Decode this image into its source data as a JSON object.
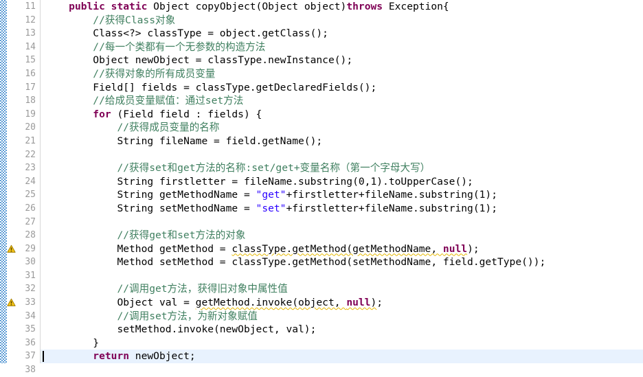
{
  "editor": {
    "app": "eclipse-java-editor",
    "language": "Java",
    "colors": {
      "keyword": "#7F0055",
      "string": "#2A00FF",
      "comment": "#3F7F5F",
      "plain": "#000000",
      "line_number": "#9A9A9A",
      "current_line_highlight": "#E8F2FE",
      "warning_underline": "#E6B800",
      "annotation_strip": "#5B9BD5"
    },
    "first_line_number": 11,
    "last_line_number": 38,
    "current_line": 37,
    "fold_marker_line": 11,
    "fold_marker_glyph": "⊖",
    "warning_lines": [
      29,
      33
    ]
  },
  "lines": [
    {
      "num": "11",
      "marker": "fold",
      "indent": 4,
      "tokens": [
        {
          "t": "kw",
          "v": "public"
        },
        {
          "t": "plain",
          "v": " "
        },
        {
          "t": "kw",
          "v": "static"
        },
        {
          "t": "plain",
          "v": " Object copyObject(Object object)"
        },
        {
          "t": "kw",
          "v": "throws"
        },
        {
          "t": "plain",
          "v": " Exception{"
        }
      ]
    },
    {
      "num": "12",
      "marker": "none",
      "indent": 8,
      "tokens": [
        {
          "t": "cmt",
          "v": "//获得Class对象"
        }
      ]
    },
    {
      "num": "13",
      "marker": "none",
      "indent": 8,
      "tokens": [
        {
          "t": "plain",
          "v": "Class<?> classType = object.getClass();"
        }
      ]
    },
    {
      "num": "14",
      "marker": "none",
      "indent": 8,
      "tokens": [
        {
          "t": "cmt",
          "v": "//每一个类都有一个无参数的构造方法"
        }
      ]
    },
    {
      "num": "15",
      "marker": "none",
      "indent": 8,
      "tokens": [
        {
          "t": "plain",
          "v": "Object newObject = classType.newInstance();"
        }
      ]
    },
    {
      "num": "16",
      "marker": "none",
      "indent": 8,
      "tokens": [
        {
          "t": "cmt",
          "v": "//获得对象的所有成员变量"
        }
      ]
    },
    {
      "num": "17",
      "marker": "none",
      "indent": 8,
      "tokens": [
        {
          "t": "plain",
          "v": "Field[] fields = classType.getDeclaredFields();"
        }
      ]
    },
    {
      "num": "18",
      "marker": "none",
      "indent": 8,
      "tokens": [
        {
          "t": "cmt",
          "v": "//给成员变量赋值：通过set方法"
        }
      ]
    },
    {
      "num": "19",
      "marker": "none",
      "indent": 8,
      "tokens": [
        {
          "t": "kw",
          "v": "for"
        },
        {
          "t": "plain",
          "v": " (Field field : fields) {"
        }
      ]
    },
    {
      "num": "20",
      "marker": "none",
      "indent": 12,
      "tokens": [
        {
          "t": "cmt",
          "v": "//获得成员变量的名称"
        }
      ]
    },
    {
      "num": "21",
      "marker": "none",
      "indent": 12,
      "tokens": [
        {
          "t": "plain",
          "v": "String fileName = field.getName();"
        }
      ]
    },
    {
      "num": "22",
      "marker": "none",
      "indent": 0,
      "tokens": []
    },
    {
      "num": "23",
      "marker": "none",
      "indent": 12,
      "tokens": [
        {
          "t": "cmt",
          "v": "//获得set和get方法的名称:set/get+变量名称（第一个字母大写）"
        }
      ]
    },
    {
      "num": "24",
      "marker": "none",
      "indent": 12,
      "tokens": [
        {
          "t": "plain",
          "v": "String firstletter = fileName.substring(0,1).toUpperCase();"
        }
      ]
    },
    {
      "num": "25",
      "marker": "none",
      "indent": 12,
      "tokens": [
        {
          "t": "plain",
          "v": "String getMethodName = "
        },
        {
          "t": "str",
          "v": "\"get\""
        },
        {
          "t": "plain",
          "v": "+firstletter+fileName.substring(1);"
        }
      ]
    },
    {
      "num": "26",
      "marker": "none",
      "indent": 12,
      "tokens": [
        {
          "t": "plain",
          "v": "String setMethodName = "
        },
        {
          "t": "str",
          "v": "\"set\""
        },
        {
          "t": "plain",
          "v": "+firstletter+fileName.substring(1);"
        }
      ]
    },
    {
      "num": "27",
      "marker": "none",
      "indent": 0,
      "tokens": []
    },
    {
      "num": "28",
      "marker": "none",
      "indent": 12,
      "tokens": [
        {
          "t": "cmt",
          "v": "//获得get和set方法的对象"
        }
      ]
    },
    {
      "num": "29",
      "marker": "warning",
      "indent": 12,
      "tokens": [
        {
          "t": "plain",
          "v": "Method getMethod = "
        },
        {
          "t": "plain-warn",
          "v": "classType.getMethod(getMethodName, "
        },
        {
          "t": "kw-warn",
          "v": "null"
        },
        {
          "t": "plain",
          "v": ");"
        }
      ]
    },
    {
      "num": "30",
      "marker": "none",
      "indent": 12,
      "tokens": [
        {
          "t": "plain",
          "v": "Method setMethod = classType.getMethod(setMethodName, field.getType());"
        }
      ]
    },
    {
      "num": "31",
      "marker": "none",
      "indent": 0,
      "tokens": []
    },
    {
      "num": "32",
      "marker": "none",
      "indent": 12,
      "tokens": [
        {
          "t": "cmt",
          "v": "//调用get方法，获得旧对象中属性值"
        }
      ]
    },
    {
      "num": "33",
      "marker": "warning",
      "indent": 12,
      "tokens": [
        {
          "t": "plain",
          "v": "Object val = "
        },
        {
          "t": "plain-warn",
          "v": "getMethod.invoke(object, "
        },
        {
          "t": "kw-warn",
          "v": "null"
        },
        {
          "t": "plain-warn",
          "v": ")"
        },
        {
          "t": "plain",
          "v": ";"
        }
      ]
    },
    {
      "num": "34",
      "marker": "none",
      "indent": 12,
      "tokens": [
        {
          "t": "cmt",
          "v": "//调用set方法，为新对象赋值"
        }
      ]
    },
    {
      "num": "35",
      "marker": "none",
      "indent": 12,
      "tokens": [
        {
          "t": "plain",
          "v": "setMethod.invoke(newObject, val);"
        }
      ]
    },
    {
      "num": "36",
      "marker": "none",
      "indent": 8,
      "tokens": [
        {
          "t": "plain",
          "v": "}"
        }
      ]
    },
    {
      "num": "37",
      "marker": "none",
      "indent": 8,
      "current": true,
      "tokens": [
        {
          "t": "kw",
          "v": "return"
        },
        {
          "t": "plain",
          "v": " newObject;"
        }
      ]
    },
    {
      "num": "38",
      "marker": "none",
      "indent": 4,
      "tokens": [
        {
          "t": "plain",
          "v": "}"
        }
      ]
    }
  ]
}
